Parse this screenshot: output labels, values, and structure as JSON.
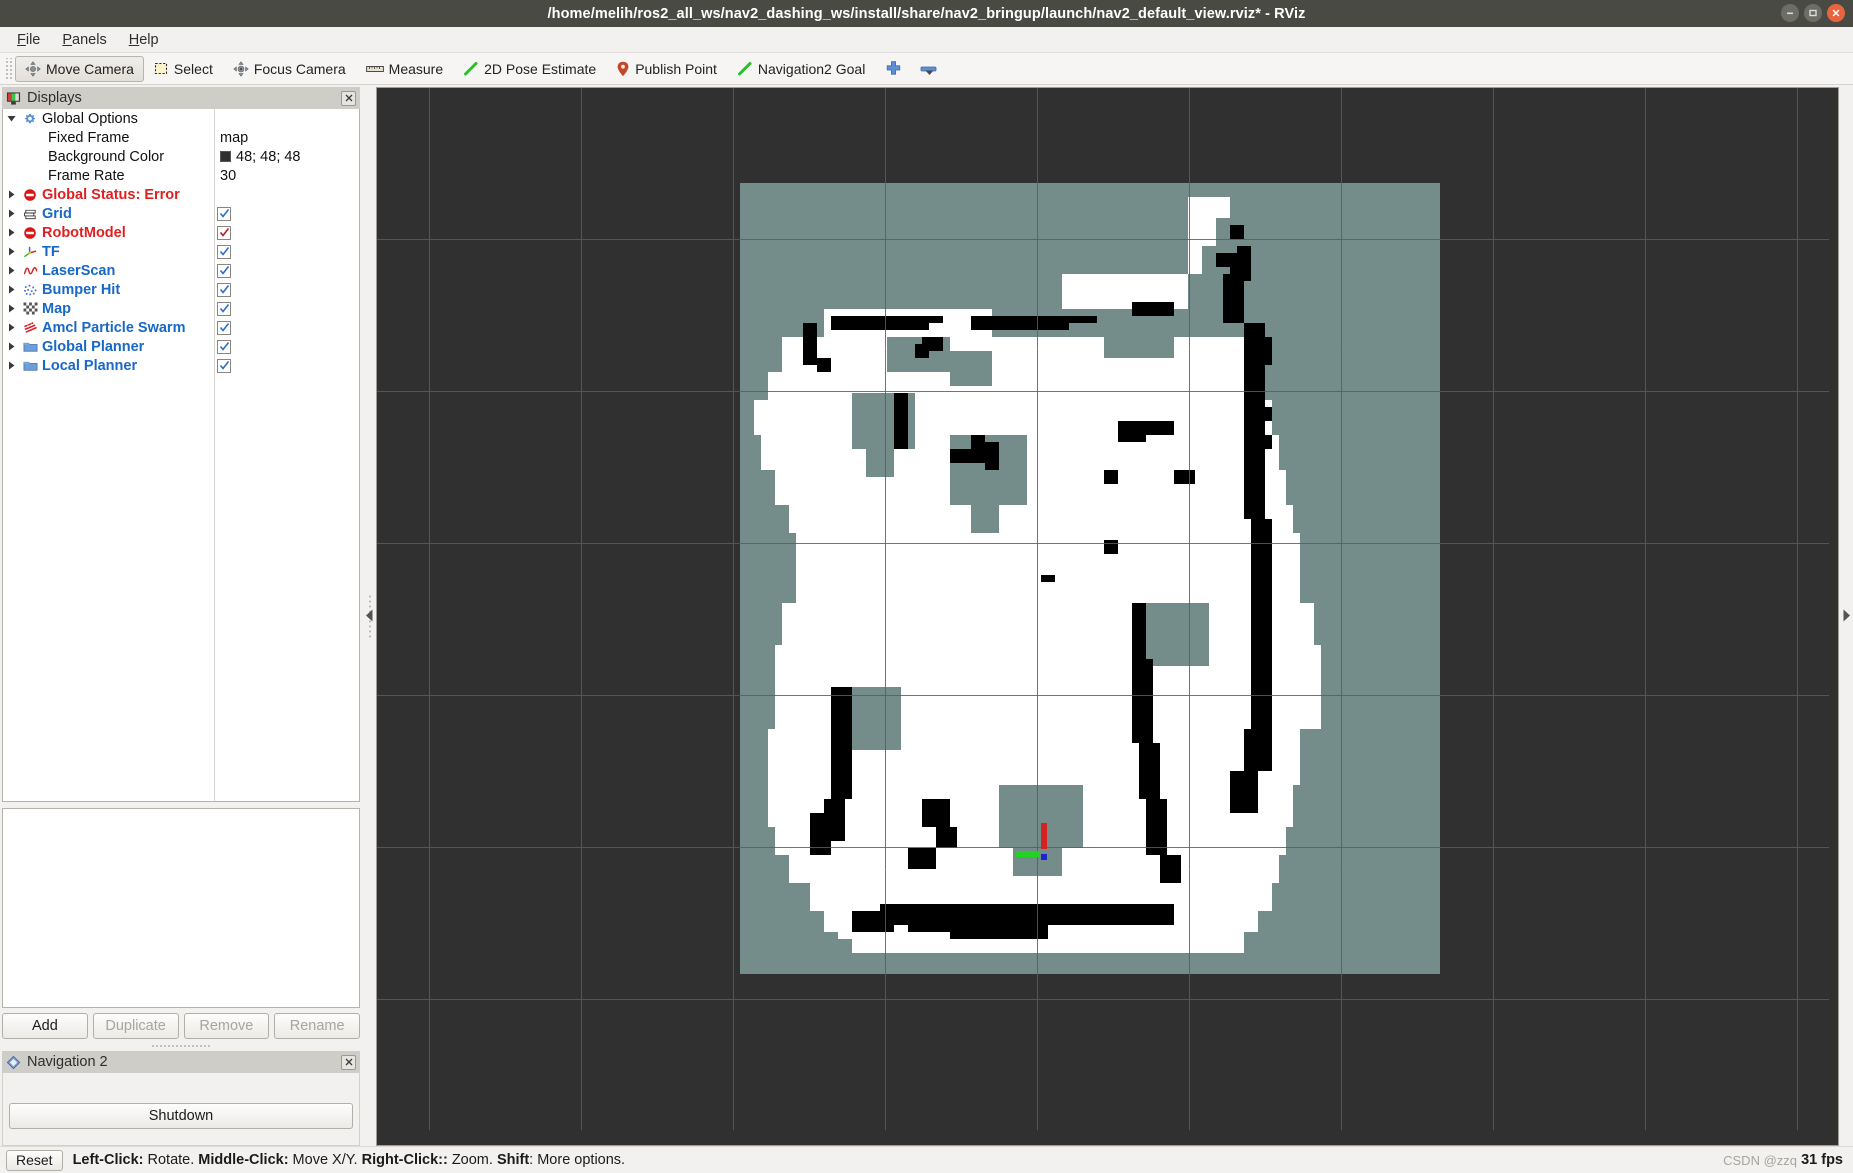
{
  "window": {
    "title": "/home/melih/ros2_all_ws/nav2_dashing_ws/install/share/nav2_bringup/launch/nav2_default_view.rviz* - RViz",
    "minimize_label": "minimize-button",
    "maximize_label": "maximize-button",
    "close_label": "close-button"
  },
  "menubar": {
    "items": [
      {
        "label": "File",
        "mnemonic": "F"
      },
      {
        "label": "Panels",
        "mnemonic": "P"
      },
      {
        "label": "Help",
        "mnemonic": "H"
      }
    ]
  },
  "toolbar": {
    "items": [
      {
        "label": "Move Camera",
        "icon": "move-camera-icon",
        "active": true
      },
      {
        "label": "Select",
        "icon": "select-icon",
        "active": false
      },
      {
        "label": "Focus Camera",
        "icon": "focus-camera-icon",
        "active": false
      },
      {
        "label": "Measure",
        "icon": "measure-icon",
        "active": false
      },
      {
        "label": "2D Pose Estimate",
        "icon": "pose-estimate-icon",
        "active": false
      },
      {
        "label": "Publish Point",
        "icon": "publish-point-icon",
        "active": false
      },
      {
        "label": "Navigation2 Goal",
        "icon": "navigation-goal-icon",
        "active": false
      }
    ],
    "plus_icon": "plus-icon",
    "minus_icon": "minus-icon",
    "overflow_icon": "chevron-down-icon"
  },
  "displays_panel": {
    "title": "Displays",
    "title_icon": "displays-icon",
    "close_icon": "close-icon",
    "tree": [
      {
        "label": "Global Options",
        "kind": "group",
        "expanded": true,
        "icon": "gear-icon",
        "color": "dark",
        "value": ""
      },
      {
        "label": "Fixed Frame",
        "kind": "property",
        "icon": "",
        "color": "dark",
        "value": "map"
      },
      {
        "label": "Background Color",
        "kind": "property",
        "icon": "",
        "color": "dark",
        "value": "48; 48; 48",
        "swatch": "#303030"
      },
      {
        "label": "Frame Rate",
        "kind": "property",
        "icon": "",
        "color": "dark",
        "value": "30"
      },
      {
        "label": "Global Status: Error",
        "kind": "status",
        "expanded": false,
        "icon": "error-icon",
        "color": "red",
        "value": ""
      },
      {
        "label": "Grid",
        "kind": "display",
        "expanded": false,
        "icon": "grid-icon",
        "color": "blue",
        "checked": true
      },
      {
        "label": "RobotModel",
        "kind": "display",
        "expanded": false,
        "icon": "error-icon",
        "color": "red",
        "checked": true,
        "check_color": "#b22222"
      },
      {
        "label": "TF",
        "kind": "display",
        "expanded": false,
        "icon": "tf-icon",
        "color": "blue",
        "checked": true
      },
      {
        "label": "LaserScan",
        "kind": "display",
        "expanded": false,
        "icon": "laserscan-icon",
        "color": "blue",
        "checked": true
      },
      {
        "label": "Bumper Hit",
        "kind": "display",
        "expanded": false,
        "icon": "pointcloud-icon",
        "color": "blue",
        "checked": true
      },
      {
        "label": "Map",
        "kind": "display",
        "expanded": false,
        "icon": "map-icon",
        "color": "blue",
        "checked": true
      },
      {
        "label": "Amcl Particle Swarm",
        "kind": "display",
        "expanded": false,
        "icon": "poisearray-icon",
        "color": "blue",
        "checked": true
      },
      {
        "label": "Global Planner",
        "kind": "display",
        "expanded": false,
        "icon": "folder-icon",
        "color": "blue",
        "checked": true
      },
      {
        "label": "Local Planner",
        "kind": "display",
        "expanded": false,
        "icon": "folder-icon",
        "color": "blue",
        "checked": true
      }
    ],
    "buttons": [
      {
        "label": "Add",
        "enabled": true
      },
      {
        "label": "Duplicate",
        "enabled": false
      },
      {
        "label": "Remove",
        "enabled": false
      },
      {
        "label": "Rename",
        "enabled": false
      }
    ]
  },
  "navigation_panel": {
    "title": "Navigation 2",
    "title_icon": "navigation-icon",
    "close_icon": "close-icon",
    "shutdown_label": "Shutdown"
  },
  "statusbar": {
    "reset_label": "Reset",
    "hint_parts": [
      {
        "text": "Left-Click:",
        "bold": true
      },
      {
        "text": " Rotate. ",
        "bold": false
      },
      {
        "text": "Middle-Click:",
        "bold": true
      },
      {
        "text": " Move X/Y. ",
        "bold": false
      },
      {
        "text": "Right-Click::",
        "bold": true
      },
      {
        "text": " Zoom. ",
        "bold": false
      },
      {
        "text": "Shift",
        "bold": true
      },
      {
        "text": ": More options.",
        "bold": false
      }
    ],
    "fps": "31 fps",
    "watermark": "CSDN @zzq"
  },
  "view3d": {
    "background_color": "#303030",
    "grid_color": "#5c5c5c",
    "map_unknown_color": "#748d8a",
    "map_free_color": "#ffffff",
    "map_occupied_color": "#000000",
    "tf_axis_x_color": "#d42222",
    "tf_axis_y_color": "#22d422",
    "tf_axis_z_color": "#2222d4",
    "collapse_left_icon": "collapse-left-icon",
    "collapse_right_icon": "collapse-right-icon"
  }
}
